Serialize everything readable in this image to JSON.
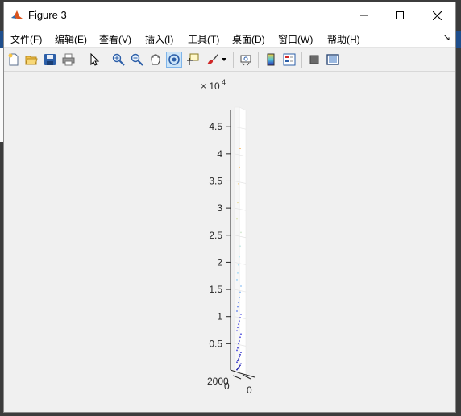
{
  "window": {
    "title": "Figure 3",
    "controls": [
      "minimize",
      "maximize",
      "close"
    ]
  },
  "menubar": {
    "items": [
      "文件(F)",
      "编辑(E)",
      "查看(V)",
      "插入(I)",
      "工具(T)",
      "桌面(D)",
      "窗口(W)",
      "帮助(H)"
    ],
    "overflow": "↘"
  },
  "toolbar": {
    "buttons": [
      "new-figure-icon",
      "open-icon",
      "save-icon",
      "print-icon",
      "edit-plot-icon",
      "zoom-in-icon",
      "zoom-out-icon",
      "pan-icon",
      "rotate-3d-icon",
      "data-cursor-icon",
      "brush-icon",
      "brush-dropdown-icon",
      "link-plot-icon",
      "colorbar-icon",
      "legend-icon",
      "hide-plot-tools-icon",
      "show-plot-tools-icon"
    ],
    "active": "rotate-3d-icon"
  },
  "chart_data": {
    "type": "scatter",
    "view": "3d",
    "exponent_label": "× 10",
    "exponent_power": "4",
    "z_ticks": [
      5000,
      10000,
      15000,
      20000,
      25000,
      30000,
      35000,
      40000,
      45000
    ],
    "z_tick_labels": [
      "0.5",
      "1",
      "1.5",
      "2",
      "2.5",
      "3",
      "3.5",
      "4",
      "4.5"
    ],
    "zlim": [
      0,
      48000
    ],
    "x_tick_labels": [
      "0"
    ],
    "y_tick_labels": [
      "0"
    ],
    "bottom_label": "2000",
    "grid": true,
    "points": [
      {
        "z": 200,
        "c": "#1c1caa"
      },
      {
        "z": 400,
        "c": "#1c1caa"
      },
      {
        "z": 600,
        "c": "#2424b8"
      },
      {
        "z": 800,
        "c": "#1c1caa"
      },
      {
        "z": 1000,
        "c": "#2a2ac0"
      },
      {
        "z": 1300,
        "c": "#2424b8"
      },
      {
        "z": 1600,
        "c": "#3030c8"
      },
      {
        "z": 1900,
        "c": "#2424b8"
      },
      {
        "z": 2200,
        "c": "#3030c8"
      },
      {
        "z": 2600,
        "c": "#3838d0"
      },
      {
        "z": 3000,
        "c": "#2a2ac0"
      },
      {
        "z": 3400,
        "c": "#3838d0"
      },
      {
        "z": 3800,
        "c": "#4040d8"
      },
      {
        "z": 4200,
        "c": "#3838d0"
      },
      {
        "z": 5000,
        "c": "#4646dc"
      },
      {
        "z": 5500,
        "c": "#4040d8"
      },
      {
        "z": 6200,
        "c": "#4c4ce0"
      },
      {
        "z": 6800,
        "c": "#4646dc"
      },
      {
        "z": 7400,
        "c": "#4c4ce0"
      },
      {
        "z": 8000,
        "c": "#5050e0"
      },
      {
        "z": 8600,
        "c": "#4c4ce0"
      },
      {
        "z": 9200,
        "c": "#5656e4"
      },
      {
        "z": 9800,
        "c": "#5050e0"
      },
      {
        "z": 10400,
        "c": "#5a5ae6"
      },
      {
        "z": 11000,
        "c": "#5a7ae8"
      },
      {
        "z": 11800,
        "c": "#6a8aea"
      },
      {
        "z": 12600,
        "c": "#7090ec"
      },
      {
        "z": 13500,
        "c": "#7aa6ee"
      },
      {
        "z": 14500,
        "c": "#84b4f0"
      },
      {
        "z": 15600,
        "c": "#8cc0f2"
      },
      {
        "z": 16800,
        "c": "#96cef4"
      },
      {
        "z": 18000,
        "c": "#9ed8f4"
      },
      {
        "z": 19500,
        "c": "#a6e0f2"
      },
      {
        "z": 21000,
        "c": "#b0e4ee"
      },
      {
        "z": 23000,
        "c": "#bfe6e0"
      },
      {
        "z": 25500,
        "c": "#cfe6cc"
      },
      {
        "z": 28000,
        "c": "#dde6b8"
      },
      {
        "z": 31000,
        "c": "#e8dca0"
      },
      {
        "z": 34500,
        "c": "#f0d088"
      },
      {
        "z": 37500,
        "c": "#f4c274"
      },
      {
        "z": 41000,
        "c": "#f6b050"
      }
    ]
  }
}
